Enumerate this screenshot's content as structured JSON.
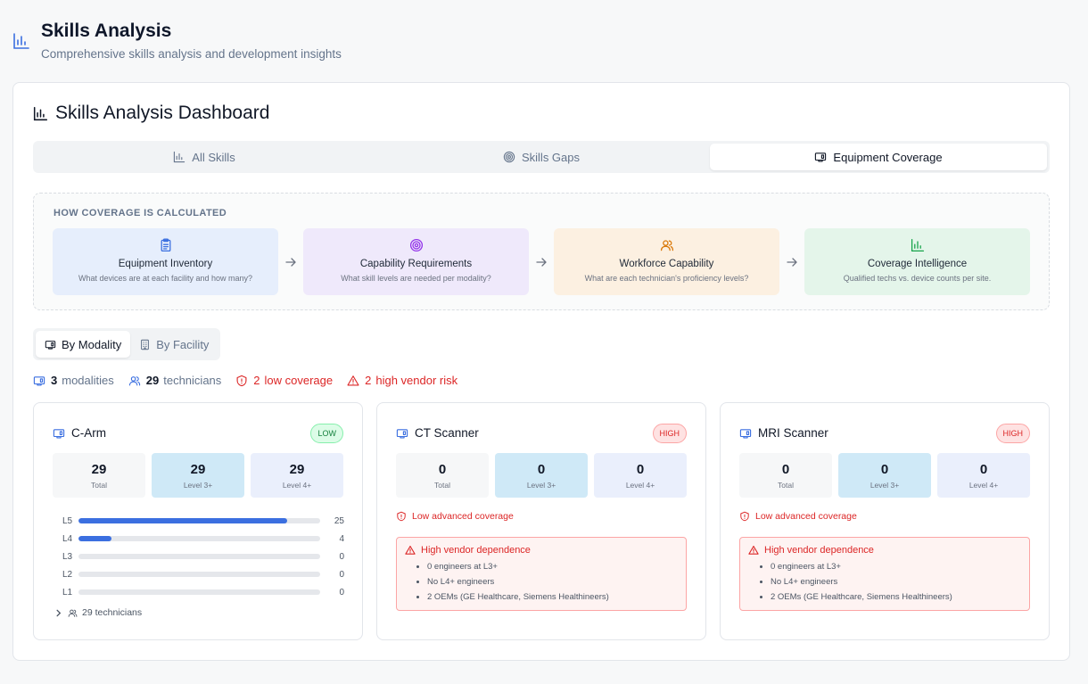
{
  "page": {
    "title": "Skills Analysis",
    "subtitle": "Comprehensive skills analysis and development insights"
  },
  "dashboard": {
    "title": "Skills Analysis Dashboard",
    "tabs": [
      {
        "label": "All Skills",
        "icon": "bar-chart-icon",
        "active": false
      },
      {
        "label": "Skills Gaps",
        "icon": "target-icon",
        "active": false
      },
      {
        "label": "Equipment Coverage",
        "icon": "equipment-icon",
        "active": true
      }
    ]
  },
  "calculation": {
    "title": "HOW COVERAGE IS CALCULATED",
    "steps": [
      {
        "title": "Equipment Inventory",
        "desc": "What devices are at each facility and how many?",
        "icon": "clipboard-icon",
        "bg": "#e6eefc",
        "color": "#3b6fe0"
      },
      {
        "title": "Capability Requirements",
        "desc": "What skill levels are needed per modality?",
        "icon": "target-icon",
        "bg": "#efe9fb",
        "color": "#9333ea"
      },
      {
        "title": "Workforce Capability",
        "desc": "What are each technician's proficiency levels?",
        "icon": "users-icon",
        "bg": "#fcf0e1",
        "color": "#d97706"
      },
      {
        "title": "Coverage Intelligence",
        "desc": "Qualified techs vs. device counts per site.",
        "icon": "bar-chart-icon",
        "bg": "#e4f5ea",
        "color": "#16a34a"
      }
    ]
  },
  "view_toggle": {
    "by_modality": "By Modality",
    "by_facility": "By Facility",
    "active": "by_modality"
  },
  "stats": {
    "modalities_count": "3",
    "modalities_label": "modalities",
    "technicians_count": "29",
    "technicians_label": "technicians",
    "low_coverage_count": "2",
    "low_coverage_label": "low coverage",
    "vendor_risk_count": "2",
    "vendor_risk_label": "high vendor risk"
  },
  "modalities": [
    {
      "name": "C-Arm",
      "badge": "LOW",
      "metrics": [
        {
          "value": "29",
          "label": "Total"
        },
        {
          "value": "29",
          "label": "Level 3+"
        },
        {
          "value": "29",
          "label": "Level 4+"
        }
      ],
      "levels": [
        {
          "name": "L5",
          "count": 25
        },
        {
          "name": "L4",
          "count": 4
        },
        {
          "name": "L3",
          "count": 0
        },
        {
          "name": "L2",
          "count": 0
        },
        {
          "name": "L1",
          "count": 0
        }
      ],
      "technicians": "29 technicians"
    },
    {
      "name": "CT Scanner",
      "badge": "HIGH",
      "metrics": [
        {
          "value": "0",
          "label": "Total"
        },
        {
          "value": "0",
          "label": "Level 3+"
        },
        {
          "value": "0",
          "label": "Level 4+"
        }
      ],
      "warning": "Low advanced coverage",
      "vendor_title": "High vendor dependence",
      "vendor_items": [
        "0 engineers at L3+",
        "No L4+ engineers",
        "2 OEMs (GE Healthcare, Siemens Healthineers)"
      ]
    },
    {
      "name": "MRI Scanner",
      "badge": "HIGH",
      "metrics": [
        {
          "value": "0",
          "label": "Total"
        },
        {
          "value": "0",
          "label": "Level 3+"
        },
        {
          "value": "0",
          "label": "Level 4+"
        }
      ],
      "warning": "Low advanced coverage",
      "vendor_title": "High vendor dependence",
      "vendor_items": [
        "0 engineers at L3+",
        "No L4+ engineers",
        "2 OEMs (GE Healthcare, Siemens Healthineers)"
      ]
    }
  ],
  "colors": {
    "accent": "#3b6fe0",
    "danger": "#dc2626",
    "success": "#15803d"
  }
}
